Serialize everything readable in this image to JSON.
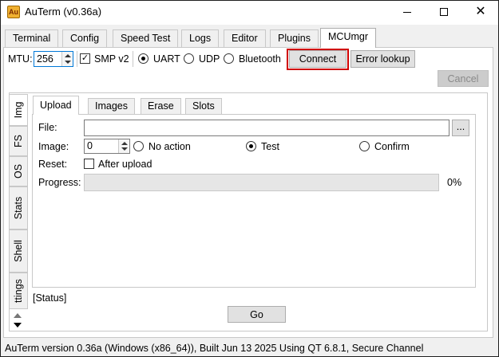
{
  "window": {
    "title": "AuTerm (v0.36a)",
    "icon": "autermo-app-icon",
    "icon_glyph": "Au"
  },
  "main_tabs": [
    {
      "label": "Terminal",
      "active": false
    },
    {
      "label": "Config",
      "active": false
    },
    {
      "label": "Speed Test",
      "active": false
    },
    {
      "label": "Logs",
      "active": false
    },
    {
      "label": "Editor",
      "active": false
    },
    {
      "label": "Plugins",
      "active": false
    },
    {
      "label": "MCUmgr",
      "active": true
    }
  ],
  "connection": {
    "mtu_label": "MTU:",
    "mtu_value": "256",
    "smp_v2_label": "SMP v2",
    "smp_v2_checked": true,
    "transports": [
      {
        "label": "UART",
        "selected": true
      },
      {
        "label": "UDP",
        "selected": false
      },
      {
        "label": "Bluetooth",
        "selected": false
      }
    ],
    "connect_label": "Connect",
    "error_lookup_label": "Error lookup",
    "cancel_label": "Cancel",
    "highlight_color": "#d00000"
  },
  "vertical_tabs": [
    {
      "label": "Img",
      "active": true
    },
    {
      "label": "FS",
      "active": false
    },
    {
      "label": "OS",
      "active": false
    },
    {
      "label": "Stats",
      "active": false
    },
    {
      "label": "Shell",
      "active": false
    },
    {
      "label": "ttings",
      "active": false
    }
  ],
  "img_tabs": [
    {
      "label": "Upload",
      "active": true
    },
    {
      "label": "Images",
      "active": false
    },
    {
      "label": "Erase",
      "active": false
    },
    {
      "label": "Slots",
      "active": false
    }
  ],
  "upload": {
    "file_label": "File:",
    "file_value": "",
    "browse_label": "...",
    "image_label": "Image:",
    "image_value": "0",
    "actions": [
      {
        "label": "No action",
        "selected": false
      },
      {
        "label": "Test",
        "selected": true
      },
      {
        "label": "Confirm",
        "selected": false
      }
    ],
    "reset_label": "Reset:",
    "after_upload_label": "After upload",
    "after_upload_checked": false,
    "progress_label": "Progress:",
    "progress_value": 0,
    "progress_text": "0%"
  },
  "status_label": "[Status]",
  "go_label": "Go",
  "statusbar": "AuTerm version 0.36a (Windows (x86_64)), Built Jun 13 2025 Using QT 6.8.1, Secure Channel"
}
